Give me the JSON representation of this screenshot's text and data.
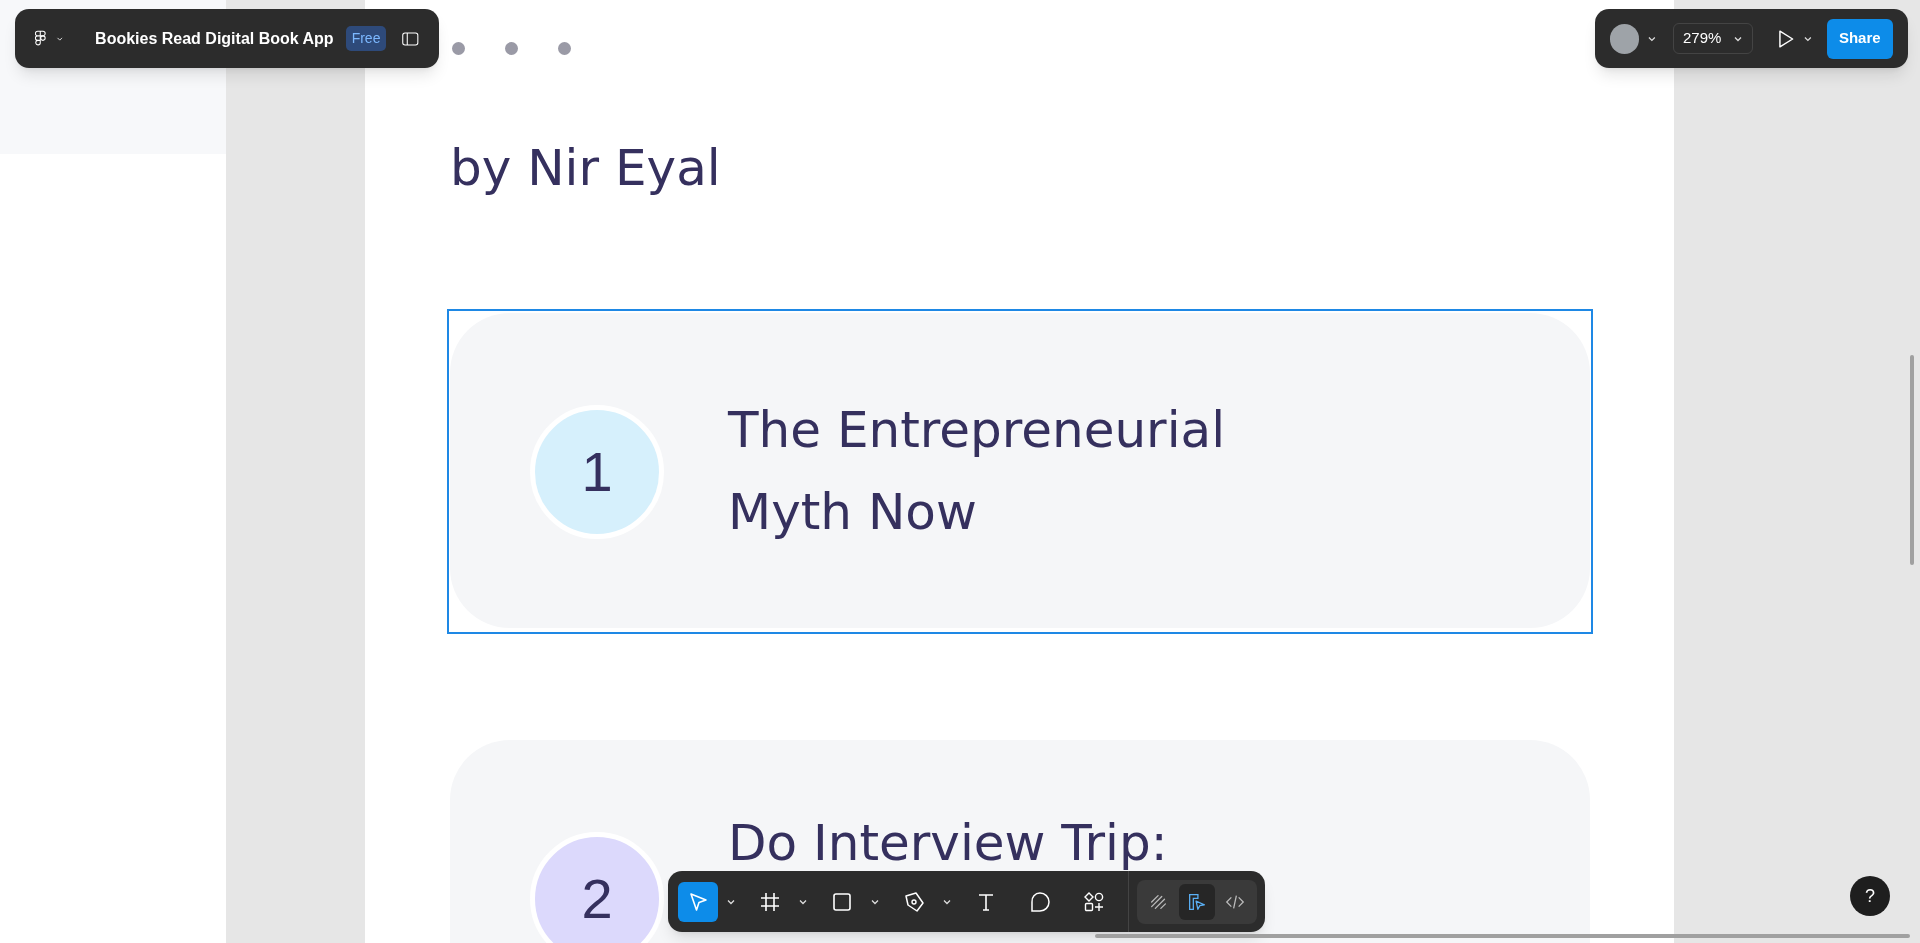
{
  "file_bar": {
    "file_name": "Bookies Read Digital Book App",
    "plan_badge": "Free"
  },
  "right_bar": {
    "zoom": "279%",
    "share": "Share"
  },
  "canvas": {
    "author": "by Nir Eyal",
    "chapters": [
      {
        "number": "1",
        "title_lines": [
          "The Entrepreneurial",
          "Myth Now"
        ],
        "color": "#d6f0fc",
        "selected": true
      },
      {
        "number": "2",
        "title_lines": [
          "Do Interview Trip:"
        ],
        "color": "#dcd9fc",
        "selected": false
      }
    ]
  },
  "toolbar": {
    "tools": [
      {
        "kind": "move",
        "selected": true,
        "caret": true
      },
      {
        "kind": "frame",
        "selected": false,
        "caret": true
      },
      {
        "kind": "rectangle",
        "selected": false,
        "caret": true
      },
      {
        "kind": "pen",
        "selected": false,
        "caret": true
      },
      {
        "kind": "text",
        "selected": false,
        "caret": false
      },
      {
        "kind": "comment",
        "selected": false,
        "caret": false
      },
      {
        "kind": "actions",
        "selected": false,
        "caret": false
      }
    ],
    "modes": [
      {
        "kind": "draw",
        "selected": false
      },
      {
        "kind": "design",
        "selected": true
      },
      {
        "kind": "dev",
        "selected": false
      }
    ]
  },
  "help": "?"
}
